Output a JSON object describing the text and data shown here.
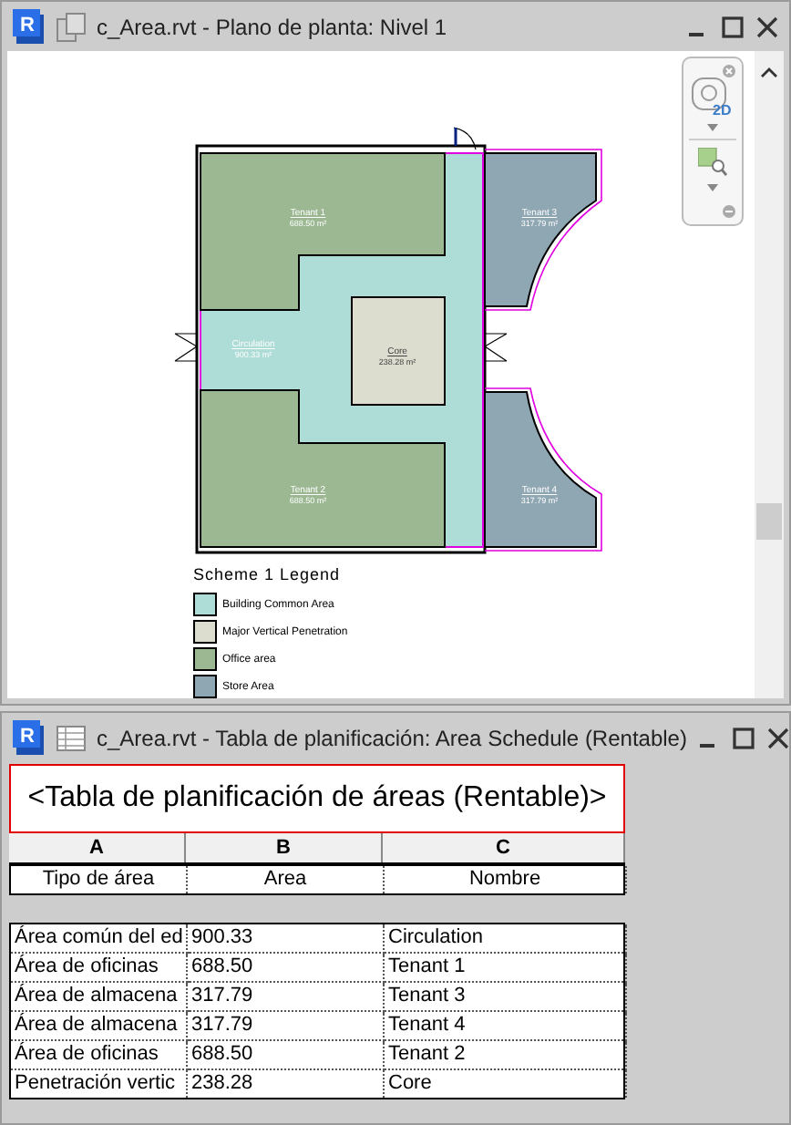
{
  "app_logo": "R",
  "plan_window": {
    "title": "c_Area.rvt - Plano de planta: Nivel 1",
    "nav_wheel_label": "2D",
    "rooms": [
      {
        "name": "Tenant 1",
        "area": "688.50 m²",
        "kind": "office"
      },
      {
        "name": "Tenant 3",
        "area": "317.79 m²",
        "kind": "store"
      },
      {
        "name": "Circulation",
        "area": "900.33 m²",
        "kind": "common"
      },
      {
        "name": "Core",
        "area": "238.28 m²",
        "kind": "core"
      },
      {
        "name": "Tenant 2",
        "area": "688.50 m²",
        "kind": "office"
      },
      {
        "name": "Tenant 4",
        "area": "317.79 m²",
        "kind": "store"
      }
    ],
    "legend": {
      "title": "Scheme 1 Legend",
      "items": [
        {
          "label": "Building Common Area",
          "color": "#aedcd6"
        },
        {
          "label": "Major Vertical Penetration",
          "color": "#dcdccf"
        },
        {
          "label": "Office area",
          "color": "#9cb893"
        },
        {
          "label": "Store Area",
          "color": "#8fa6b3"
        }
      ]
    }
  },
  "schedule_window": {
    "logo": "R",
    "title": "c_Area.rvt - Tabla de planificación: Area Schedule (Rentable)",
    "heading": "<Tabla de planificación de áreas (Rentable)>",
    "columns": [
      {
        "letter": "A",
        "name": "Tipo de área"
      },
      {
        "letter": "B",
        "name": "Area"
      },
      {
        "letter": "C",
        "name": "Nombre"
      }
    ],
    "rows": [
      [
        "Área común del ed",
        "900.33",
        "Circulation"
      ],
      [
        "Área de oficinas",
        "688.50",
        "Tenant 1"
      ],
      [
        "Área de almacena",
        "317.79",
        "Tenant 3"
      ],
      [
        "Área de almacena",
        "317.79",
        "Tenant 4"
      ],
      [
        "Área de oficinas",
        "688.50",
        "Tenant 2"
      ],
      [
        "Penetración vertic",
        "238.28",
        "Core"
      ]
    ]
  }
}
